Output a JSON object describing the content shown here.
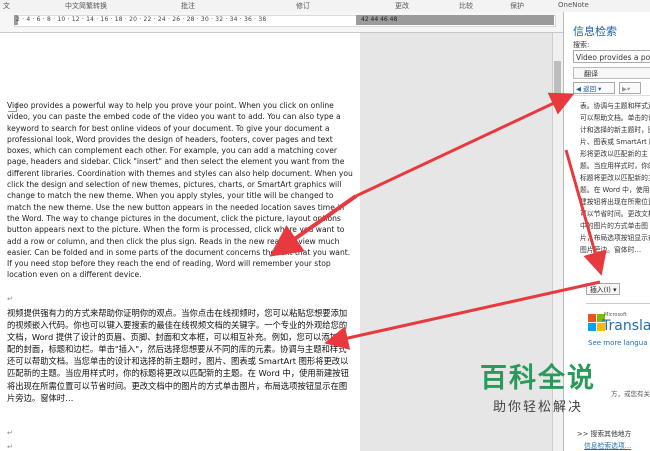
{
  "ribbon": {
    "groups": [
      "文",
      "中文简繁转换",
      "批注",
      "修订",
      "更改",
      "比较",
      "保护",
      "OneNote"
    ]
  },
  "ruler": {
    "numbers_left": "2  ·  4  ·  6  ·  8  ·  10  ·  12  ·  14  ·  16  ·  18  ·  20  ·  22  ·  24  ·  26  ·  28  ·  30  ·  32  ·  34  ·  36  ·  38",
    "numbers_right": "42    44    46    48"
  },
  "document": {
    "english_paragraph": "Video provides a powerful way to help you prove your point. When you click on online video, you can paste the embed code of the video you want to add. You can also type a keyword to search for best online videos of your document. To give your document a professional look, Word provides the design of headers, footers, cover pages and text boxes, which can complement each other. For example, you can add a matching cover page, headers and sidebar. Click \"insert\" and then select the element you want from the different libraries. Coordination with themes and styles can also help document. When you click the design and selection of new themes, pictures, charts, or SmartArt graphics will change to match the new theme. When you apply styles, your title will be changed to match the new theme. Use the new button appears in the needed location saves time in the Word. The way to change pictures in the document, click the picture, layout options button appears next to the picture. When the form is processed, click where you want to add a row or column, and then click the plus sign. Reads in the new reading view much easier. Can be folded and in some parts of the document concerns the text that you want. If you need stop before they reach the end of reading, Word will remember your stop location even on a different device.",
    "chinese_paragraph": "视频提供强有力的方式来帮助你证明你的观点。当你点击在线视频时，您可以粘贴您想要添加的视频嵌入代码。你也可以键入要搜索的最佳在线视频文档的关键字。一个专业的外观给您的文档，Word 提供了设计的页眉、页脚、封面和文本框，可以相互补充。例如，您可以添加匹配的封面，标题和边栏。单击\"插入\"，然后选择您想要从不同的库的元素。协调与主题和样式还可以帮助文档。当您单击的设计和选择的新主题时，图片、图表或 SmartArt 图形将更改以匹配新的主题。当应用样式时，你的标题将更改以匹配新的主题。在 Word 中，使用新建按钮将出现在所需位置可以节省时间。更改文档中的图片的方式单击图片，布局选项按钮显示在图片旁边。窗体时…",
    "para_mark": "↵"
  },
  "research_pane": {
    "title": "信息检索",
    "search_label": "搜索:",
    "search_value": "Video provides a po",
    "translate_label": "翻译",
    "back_label": "返回",
    "result_text": "表。协调与主题和样式还可以帮助文档。单击的设计和选择的新主题时，图片、图表或 SmartArt 图形将更改以匹配新的主题。当应用样式时，你的标题将更改以匹配新的主题。在 Word 中，使用新建按钮将出现在所需位置可以节省时间。更改文档中的图片的方式单击图片，布局选项按钮显示在图片旁边。窗体时…",
    "insert_label": "插入(I)",
    "ms_label": "Microsoft",
    "translator_label": "Translat",
    "see_more_label": "See more langua",
    "extra_text": "方，或您有关优化",
    "other_search_label": ">> 搜索其他地方",
    "options_label": "信息检索选项..."
  },
  "watermark": {
    "title": "百科全说",
    "subtitle": "助你轻松解决"
  },
  "colors": {
    "arrow": "#e8393f",
    "pane_title": "#1f5fa0",
    "watermark_green": "#2a9a5a"
  }
}
